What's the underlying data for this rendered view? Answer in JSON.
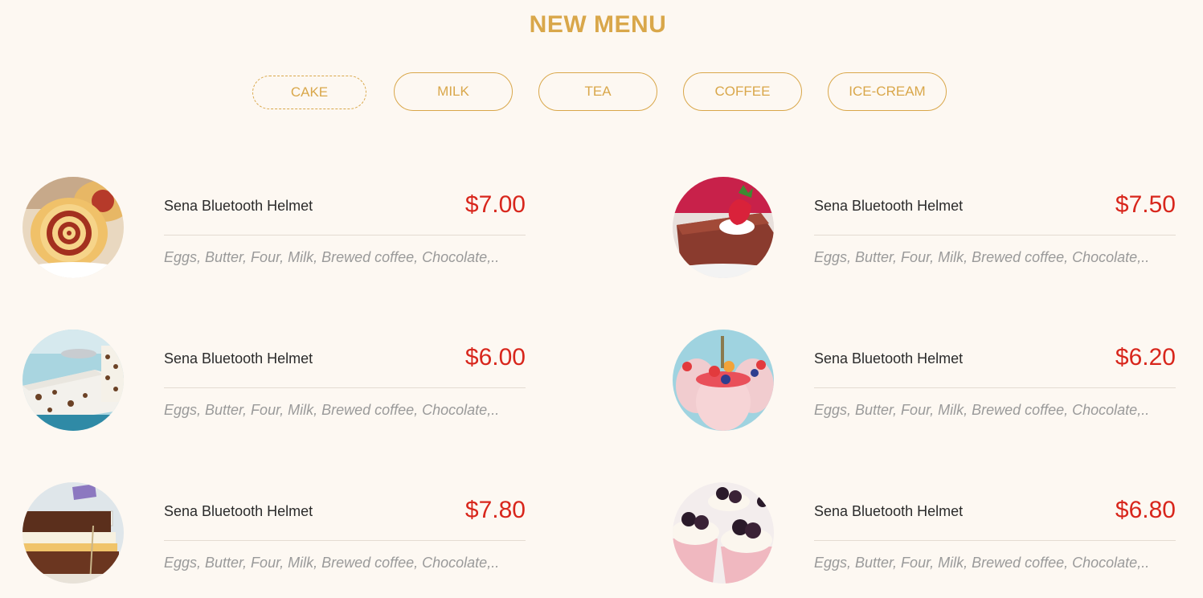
{
  "section": {
    "title": "NEW MENU"
  },
  "tabs": [
    {
      "label": "CAKE",
      "active": true
    },
    {
      "label": "MILK",
      "active": false
    },
    {
      "label": "TEA",
      "active": false
    },
    {
      "label": "COFFEE",
      "active": false
    },
    {
      "label": "ICE-CREAM",
      "active": false
    }
  ],
  "colors": {
    "accent": "#d9a74a",
    "price": "#d8261c",
    "background": "#fdf8f2"
  },
  "items": [
    {
      "name": "Sena Bluetooth Helmet",
      "price": "$7.00",
      "description": "Eggs, Butter, Four, Milk, Brewed coffee, Chocolate,..",
      "image": "swiss-roll-cake-image"
    },
    {
      "name": "Sena Bluetooth Helmet",
      "price": "$7.50",
      "description": "Eggs, Butter, Four, Milk, Brewed coffee, Chocolate,..",
      "image": "strawberry-brownie-image"
    },
    {
      "name": "Sena Bluetooth Helmet",
      "price": "$6.00",
      "description": "Eggs, Butter, Four, Milk, Brewed coffee, Chocolate,..",
      "image": "ice-cream-cake-image"
    },
    {
      "name": "Sena Bluetooth Helmet",
      "price": "$6.20",
      "description": "Eggs, Butter, Four, Milk, Brewed coffee, Chocolate,..",
      "image": "berry-mousse-image"
    },
    {
      "name": "Sena Bluetooth Helmet",
      "price": "$7.80",
      "description": "Eggs, Butter, Four, Milk, Brewed coffee, Chocolate,..",
      "image": "layered-bar-cake-image"
    },
    {
      "name": "Sena Bluetooth Helmet",
      "price": "$6.80",
      "description": "Eggs, Butter, Four, Milk, Brewed coffee, Chocolate,..",
      "image": "blackberry-cupcake-image"
    }
  ]
}
